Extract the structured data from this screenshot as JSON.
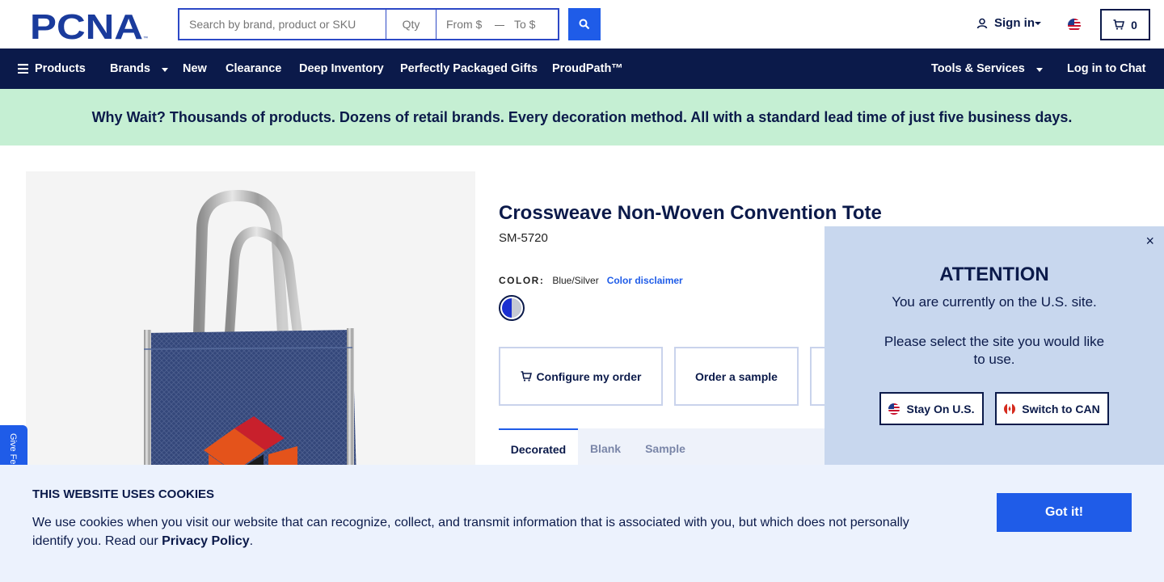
{
  "header": {
    "logo_text": "PCNA",
    "search": {
      "placeholder": "Search by brand, product or SKU",
      "qty_placeholder": "Qty",
      "from_placeholder": "From $",
      "dash": "—",
      "to_placeholder": "To $"
    },
    "signin_label": "Sign in",
    "cart_count": "0",
    "icons": {
      "search": "search-icon",
      "user": "user-icon",
      "cart": "cart-icon",
      "flag": "us-flag-icon"
    }
  },
  "nav": {
    "items": [
      {
        "label": "Products"
      },
      {
        "label": "Brands"
      },
      {
        "label": "New"
      },
      {
        "label": "Clearance"
      },
      {
        "label": "Deep Inventory"
      },
      {
        "label": "Perfectly Packaged Gifts"
      },
      {
        "label": "ProudPath™"
      }
    ],
    "tools_label": "Tools & Services",
    "chat_label": "Log in to Chat"
  },
  "promo_text": "Why Wait? Thousands of products. Dozens of retail brands. Every decoration method. All with a standard lead time of just five business days.",
  "product": {
    "title": "Crossweave Non-Woven Convention Tote",
    "sku": "SM-5720",
    "color_label": "COLOR:",
    "color_value": "Blue/Silver",
    "color_disclaimer": "Color disclaimer",
    "swatch_colors": [
      "#1a2fd1",
      "#c5c9d4"
    ],
    "actions": {
      "configure": "Configure my order",
      "sample": "Order a sample"
    },
    "tabs": [
      "Decorated",
      "Blank",
      "Sample"
    ]
  },
  "feedback_label": "Give Fe",
  "attention_modal": {
    "title": "ATTENTION",
    "message": "You are currently on the U.S. site.",
    "prompt": "Please select the site you would like to use.",
    "close": "×",
    "stay_label": "Stay On U.S.",
    "switch_label": "Switch to CAN"
  },
  "cookie_banner": {
    "title": "THIS WEBSITE USES COOKIES",
    "text": "We use cookies when you visit our website that can recognize, collect, and transmit information that is associated with you, but which does not personally identify you. Read our",
    "link": "Privacy Policy",
    "period": ".",
    "button": "Got it!"
  },
  "colors": {
    "navy": "#0b1a4a",
    "blue": "#1f5ce8",
    "promo_bg": "#c5efd3",
    "modal_bg": "#c8d7ee",
    "cookie_bg": "#ecf2fd"
  }
}
